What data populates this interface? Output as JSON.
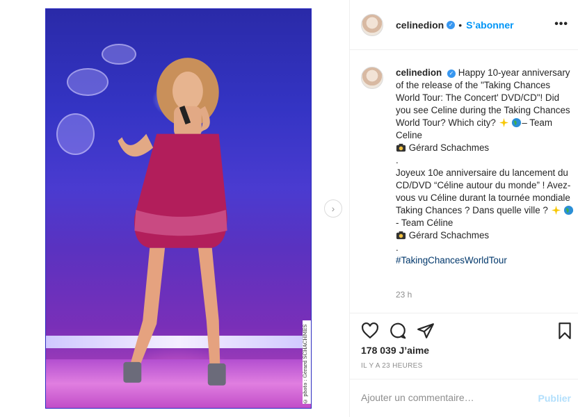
{
  "post": {
    "username": "celinedion",
    "follow_separator": "•",
    "follow_label": "S’abonner",
    "more_label": "•••",
    "photo_credit": "© photo : Gérard SCHACHMES"
  },
  "caption": {
    "username": "celinedion",
    "en_text_1": "Happy 10-year anniversary of the release of the \"Taking Chances World Tour: The Concert' DVD/CD\"! Did you see Celine during the Taking Chances World Tour? Which city?",
    "en_team": "– Team Celine",
    "credit": "Gérard Schachmes",
    "dot1": ".",
    "fr_text_1": "Joyeux 10e anniversaire du lancement du CD/DVD “Céline autour du monde” ! Avez-vous vu Céline durant la tournée mondiale Taking Chances ? Dans quelle ville ?",
    "fr_team": " - Team Céline",
    "credit2": "Gérard Schachmes",
    "dot2": ".",
    "hashtag": "#TakingChancesWorldTour",
    "time": "23 h"
  },
  "stats": {
    "likes": "178 039 J’aime",
    "ago": "IL Y A 23 HEURES"
  },
  "comment": {
    "placeholder": "Ajouter un commentaire…",
    "publish_label": "Publier"
  },
  "icons": [
    "heart-icon",
    "comment-icon",
    "share-icon",
    "bookmark-icon",
    "chevron-right-icon",
    "sparkles-icon",
    "globe-icon",
    "camera-icon",
    "verified-icon"
  ],
  "colors": {
    "accent": "#0095f6",
    "publish_disabled": "#b2dffc",
    "verified": "#3897f0"
  }
}
